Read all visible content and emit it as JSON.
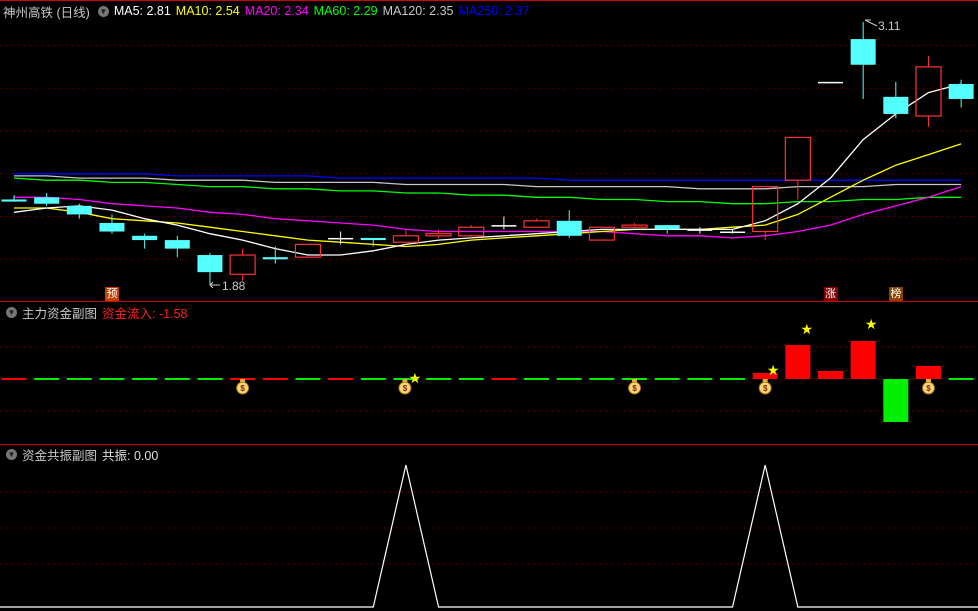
{
  "header": {
    "title": "神州高铁 (日线)",
    "ma": [
      {
        "label": "MA5: 2.81",
        "color": "#ffffff"
      },
      {
        "label": "MA10: 2.54",
        "color": "#ffff00"
      },
      {
        "label": "MA20: 2.34",
        "color": "#ff00ff"
      },
      {
        "label": "MA60: 2.29",
        "color": "#00ff00"
      },
      {
        "label": "MA120: 2.35",
        "color": "#c8c8c8"
      },
      {
        "label": "MA250: 2.37",
        "color": "#0000ff"
      }
    ]
  },
  "main_panel": {
    "high_label": "3.11",
    "low_label": "1.88",
    "grid_prices": [
      2.0,
      2.2,
      2.4,
      2.6,
      2.8,
      3.0
    ],
    "colors": {
      "up": "#ff3333",
      "down": "#55ffff",
      "flat": "#ffffff"
    },
    "candles": [
      [
        2.28,
        2.3,
        2.3,
        2.27
      ],
      [
        2.29,
        2.31,
        2.25,
        2.26
      ],
      [
        2.25,
        2.26,
        2.19,
        2.21
      ],
      [
        2.17,
        2.21,
        2.12,
        2.13
      ],
      [
        2.11,
        2.12,
        2.05,
        2.09
      ],
      [
        2.09,
        2.11,
        2.01,
        2.05
      ],
      [
        2.02,
        2.03,
        1.88,
        1.94
      ],
      [
        1.93,
        2.05,
        1.9,
        2.02
      ],
      [
        2.01,
        2.06,
        1.98,
        2.0
      ],
      [
        2.01,
        2.07,
        2.01,
        2.07
      ],
      [
        2.1,
        2.13,
        2.07,
        2.1
      ],
      [
        2.1,
        2.1,
        2.06,
        2.09
      ],
      [
        2.08,
        2.14,
        2.08,
        2.11
      ],
      [
        2.11,
        2.14,
        2.1,
        2.12
      ],
      [
        2.11,
        2.16,
        2.1,
        2.15
      ],
      [
        2.16,
        2.2,
        2.14,
        2.16
      ],
      [
        2.15,
        2.19,
        2.15,
        2.18
      ],
      [
        2.18,
        2.23,
        2.1,
        2.11
      ],
      [
        2.09,
        2.15,
        2.09,
        2.15
      ],
      [
        2.15,
        2.17,
        2.15,
        2.16
      ],
      [
        2.16,
        2.16,
        2.12,
        2.14
      ],
      [
        2.14,
        2.15,
        2.12,
        2.14
      ],
      [
        2.13,
        2.14,
        2.12,
        2.13
      ],
      [
        2.13,
        2.34,
        2.09,
        2.34
      ],
      [
        2.37,
        2.57,
        2.28,
        2.57
      ],
      [
        2.83,
        2.83,
        2.83,
        2.83
      ],
      [
        3.03,
        3.11,
        2.75,
        2.91
      ],
      [
        2.76,
        2.83,
        2.66,
        2.68
      ],
      [
        2.67,
        2.95,
        2.62,
        2.9
      ],
      [
        2.82,
        2.84,
        2.71,
        2.75
      ]
    ],
    "ma_series": [
      {
        "name": "MA5",
        "color": "#ffffff",
        "values": [
          2.22,
          2.24,
          2.25,
          2.23,
          2.19,
          2.16,
          2.12,
          2.09,
          2.05,
          2.02,
          2.02,
          2.04,
          2.07,
          2.09,
          2.1,
          2.11,
          2.12,
          2.13,
          2.14,
          2.14,
          2.14,
          2.14,
          2.14,
          2.18,
          2.26,
          2.38,
          2.56,
          2.68,
          2.78,
          2.82
        ]
      },
      {
        "name": "MA10",
        "color": "#ffff00",
        "values": [
          2.24,
          2.24,
          2.22,
          2.19,
          2.18,
          2.17,
          2.15,
          2.13,
          2.11,
          2.09,
          2.08,
          2.07,
          2.06,
          2.07,
          2.09,
          2.1,
          2.11,
          2.12,
          2.13,
          2.14,
          2.14,
          2.14,
          2.15,
          2.16,
          2.21,
          2.29,
          2.37,
          2.44,
          2.49,
          2.54
        ]
      },
      {
        "name": "MA20",
        "color": "#ff00ff",
        "values": [
          2.29,
          2.29,
          2.28,
          2.26,
          2.25,
          2.24,
          2.22,
          2.21,
          2.19,
          2.18,
          2.17,
          2.16,
          2.14,
          2.13,
          2.13,
          2.13,
          2.13,
          2.13,
          2.13,
          2.12,
          2.11,
          2.11,
          2.1,
          2.11,
          2.13,
          2.16,
          2.21,
          2.25,
          2.29,
          2.34
        ]
      },
      {
        "name": "MA60",
        "color": "#00ff00",
        "values": [
          2.38,
          2.37,
          2.37,
          2.36,
          2.36,
          2.35,
          2.34,
          2.34,
          2.33,
          2.33,
          2.32,
          2.32,
          2.31,
          2.31,
          2.3,
          2.3,
          2.29,
          2.29,
          2.28,
          2.28,
          2.27,
          2.27,
          2.26,
          2.26,
          2.27,
          2.27,
          2.28,
          2.28,
          2.29,
          2.29
        ]
      },
      {
        "name": "MA120",
        "color": "#c8c8c8",
        "values": [
          2.39,
          2.39,
          2.38,
          2.38,
          2.38,
          2.37,
          2.37,
          2.37,
          2.36,
          2.36,
          2.36,
          2.36,
          2.35,
          2.35,
          2.35,
          2.35,
          2.34,
          2.34,
          2.34,
          2.34,
          2.34,
          2.33,
          2.33,
          2.33,
          2.34,
          2.34,
          2.34,
          2.35,
          2.35,
          2.35
        ]
      },
      {
        "name": "MA250",
        "color": "#0000ff",
        "values": [
          2.4,
          2.4,
          2.4,
          2.4,
          2.4,
          2.39,
          2.39,
          2.39,
          2.39,
          2.39,
          2.38,
          2.38,
          2.38,
          2.38,
          2.38,
          2.38,
          2.38,
          2.37,
          2.37,
          2.37,
          2.37,
          2.37,
          2.37,
          2.37,
          2.37,
          2.37,
          2.37,
          2.37,
          2.37,
          2.37
        ]
      }
    ],
    "markers": [
      {
        "index": 3,
        "text": "预",
        "bg": "#c04000"
      },
      {
        "index": 25,
        "text": "涨",
        "bg": "#800000"
      },
      {
        "index": 27,
        "text": "榜",
        "bg": "#8a4000"
      }
    ]
  },
  "panel2": {
    "title": "主力资金副图",
    "value_label": "资金流入: -1.58",
    "bars": [
      1.5,
      -1.5,
      -1.5,
      -1.5,
      -1.5,
      -1.5,
      -2,
      1.5,
      1.5,
      -1.5,
      1.5,
      -1.5,
      -1,
      -1,
      -1,
      1.5,
      -1,
      -1,
      -1,
      -1,
      -1,
      -1,
      -1,
      6,
      34,
      8,
      38,
      -43,
      13,
      -1.58
    ],
    "bag_indices": [
      7,
      12,
      19,
      23,
      28
    ],
    "star_indices": [
      12,
      23,
      24,
      26
    ]
  },
  "panel3": {
    "title": "资金共振副图",
    "value_label": "共振: 0.00",
    "values": [
      0,
      0,
      0,
      0,
      0,
      0,
      0,
      0,
      0,
      0,
      0,
      0,
      1,
      0,
      0,
      0,
      0,
      0,
      0,
      0,
      0,
      0,
      0,
      1,
      0,
      0,
      0,
      0,
      0,
      0
    ]
  }
}
